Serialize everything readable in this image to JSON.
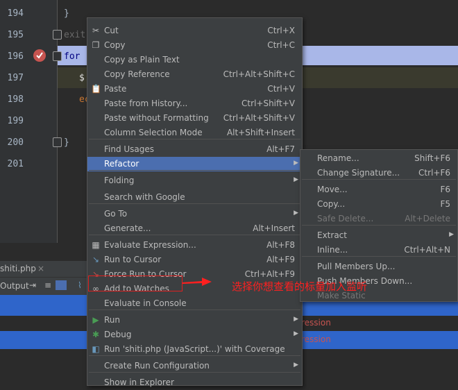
{
  "editor": {
    "lines": [
      "194",
      "195",
      "196",
      "197",
      "198",
      "199",
      "200",
      "201"
    ],
    "code": [
      {
        "text": "}"
      },
      {
        "text": "exit"
      },
      {
        "text": "for"
      },
      {
        "text": "$:"
      },
      {
        "text": "ec"
      },
      {
        "text": ""
      },
      {
        "text": "}"
      },
      {
        "text": ""
      }
    ]
  },
  "tabs": {
    "file": "shiti.php",
    "close": "×"
  },
  "toolstrip": {
    "output": "Output"
  },
  "output_rows": {
    "row1": "ression",
    "row2": "ression"
  },
  "context_menu": {
    "items": [
      {
        "label": "Cut",
        "shortcut": "Ctrl+X",
        "icon": "scissors-icon"
      },
      {
        "label": "Copy",
        "shortcut": "Ctrl+C",
        "icon": "copy-icon"
      },
      {
        "label": "Copy as Plain Text",
        "shortcut": ""
      },
      {
        "label": "Copy Reference",
        "shortcut": "Ctrl+Alt+Shift+C"
      },
      {
        "label": "Paste",
        "shortcut": "Ctrl+V",
        "icon": "clipboard-icon"
      },
      {
        "label": "Paste from History...",
        "shortcut": "Ctrl+Shift+V"
      },
      {
        "label": "Paste without Formatting",
        "shortcut": "Ctrl+Alt+Shift+V"
      },
      {
        "label": "Column Selection Mode",
        "shortcut": "Alt+Shift+Insert"
      },
      {
        "label": "Find Usages",
        "shortcut": "Alt+F7"
      },
      {
        "label": "Refactor",
        "shortcut": ""
      },
      {
        "label": "Folding",
        "shortcut": ""
      },
      {
        "label": "Search with Google",
        "shortcut": ""
      },
      {
        "label": "Go To",
        "shortcut": ""
      },
      {
        "label": "Generate...",
        "shortcut": "Alt+Insert"
      },
      {
        "label": "Evaluate Expression...",
        "shortcut": "Alt+F8",
        "icon": "calculator-icon"
      },
      {
        "label": "Run to Cursor",
        "shortcut": "Alt+F9",
        "icon": "run-to-cursor-icon"
      },
      {
        "label": "Force Run to Cursor",
        "shortcut": "Ctrl+Alt+F9",
        "icon": "force-run-to-cursor-icon"
      },
      {
        "label": "Add to Watches",
        "shortcut": "",
        "icon": "glasses-icon"
      },
      {
        "label": "Evaluate in Console",
        "shortcut": ""
      },
      {
        "label": "Run",
        "shortcut": "",
        "icon": "run-icon"
      },
      {
        "label": "Debug",
        "shortcut": "",
        "icon": "debug-icon"
      },
      {
        "label": "Run 'shiti.php (JavaScript...)' with Coverage",
        "shortcut": "",
        "icon": "coverage-icon"
      },
      {
        "label": "Create Run Configuration",
        "shortcut": ""
      },
      {
        "label": "Show in Explorer",
        "shortcut": ""
      }
    ]
  },
  "refactor_menu": {
    "items": [
      {
        "label": "Rename...",
        "shortcut": "Shift+F6"
      },
      {
        "label": "Change Signature...",
        "shortcut": "Ctrl+F6"
      },
      {
        "label": "Move...",
        "shortcut": "F6"
      },
      {
        "label": "Copy...",
        "shortcut": "F5"
      },
      {
        "label": "Safe Delete...",
        "shortcut": "Alt+Delete"
      },
      {
        "label": "Extract",
        "shortcut": ""
      },
      {
        "label": "Inline...",
        "shortcut": "Ctrl+Alt+N"
      },
      {
        "label": "Pull Members Up...",
        "shortcut": ""
      },
      {
        "label": "Push Members Down...",
        "shortcut": ""
      },
      {
        "label": "Make Static",
        "shortcut": ""
      }
    ]
  },
  "annotation": {
    "text": "选择你想查看的标量加入监听",
    "color": "#ff2020"
  },
  "colors": {
    "selection": "#4b6eaf",
    "highlight": "#2f65ca",
    "annotation": "#ff2020"
  }
}
